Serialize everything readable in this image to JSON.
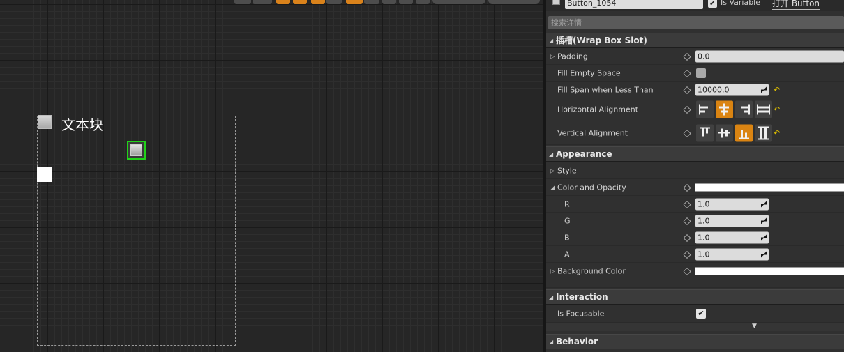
{
  "designer": {
    "textblock_label": "文本块"
  },
  "details": {
    "widget_name": "Button_1054",
    "is_variable_label": "Is Variable",
    "is_variable_checked": true,
    "open_button_label": "打开 Button",
    "search_placeholder": "搜索详情",
    "slot": {
      "title": "插槽(Wrap Box Slot)",
      "padding_label": "Padding",
      "padding_value": "0.0",
      "fill_empty_label": "Fill Empty Space",
      "fill_span_label": "Fill Span when Less Than",
      "fill_span_value": "10000.0",
      "halign_label": "Horizontal Alignment",
      "valign_label": "Vertical Alignment"
    },
    "appearance": {
      "title": "Appearance",
      "style_label": "Style",
      "color_label": "Color and Opacity",
      "r_label": "R",
      "r_value": "1.0",
      "g_label": "G",
      "g_value": "1.0",
      "b_label": "B",
      "b_value": "1.0",
      "a_label": "A",
      "a_value": "1.0",
      "bg_label": "Background Color",
      "color_hex": "#ffffff"
    },
    "interaction": {
      "title": "Interaction",
      "focusable_label": "Is Focusable",
      "focusable_checked": true
    },
    "behavior": {
      "title": "Behavior"
    }
  },
  "colors": {
    "selection_green": "#22d31a",
    "active_orange": "#da8412",
    "panel_bg": "#303030"
  },
  "icons": [
    "visibility-icon",
    "reset-arrow-icon",
    "expand-triangle-icon",
    "collapse-triangle-icon",
    "align-left-icon",
    "align-center-icon",
    "align-right-icon",
    "align-fill-icon",
    "align-top-icon",
    "align-middle-icon",
    "align-bottom-icon",
    "align-vfill-icon",
    "checkmark-icon",
    "advanced-expand-icon"
  ]
}
